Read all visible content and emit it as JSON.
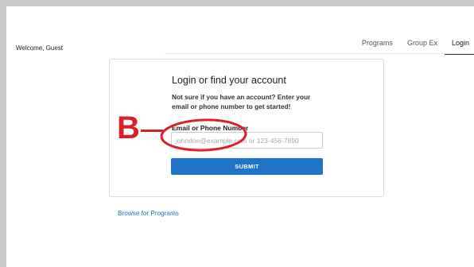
{
  "header": {
    "welcome": "Welcome, Guest",
    "nav": [
      {
        "label": "Programs"
      },
      {
        "label": "Group Ex"
      },
      {
        "label": "Login",
        "active": true
      }
    ]
  },
  "login_card": {
    "title": "Login or find your account",
    "subtitle": "Not sure if you have an account? Enter your email or phone number to get started!",
    "field_label": "Email or Phone Number",
    "field_placeholder": "johndoe@example.com or 123-456-7890",
    "field_value": "",
    "submit_label": "SUBMIT"
  },
  "links": {
    "browse": "Browse for Programs"
  },
  "annotation": {
    "letter": "B",
    "color": "#d9202b"
  },
  "colors": {
    "accent": "#1f74c8",
    "link": "#1f6fbf",
    "frame": "#c9c9c9"
  }
}
